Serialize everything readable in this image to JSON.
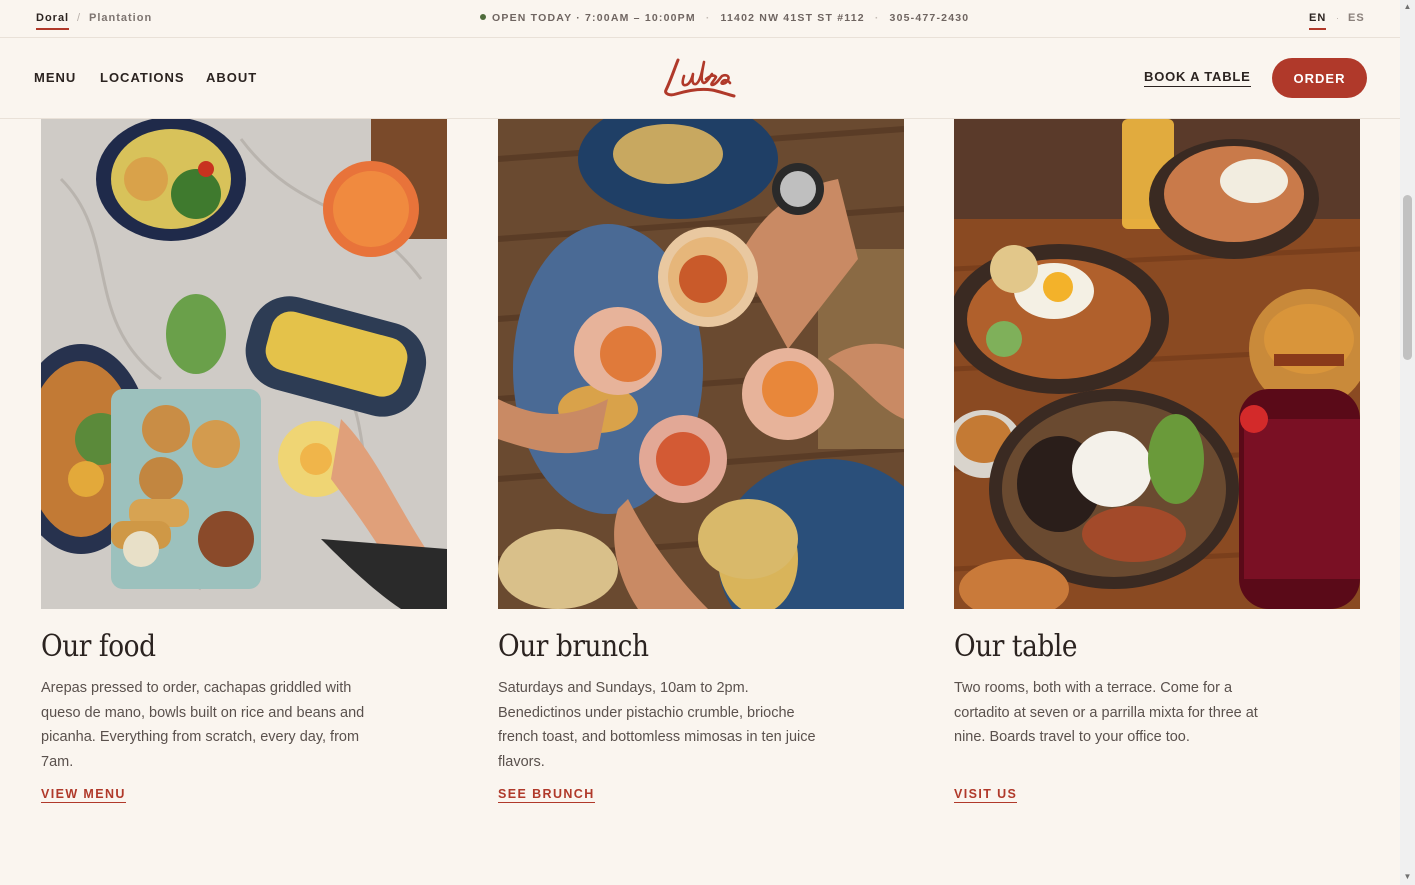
{
  "topbar": {
    "locations": [
      "Doral",
      "Plantation"
    ],
    "status": "OPEN TODAY · 7:00AM – 10:00PM",
    "address": "11402 NW 41ST ST #112",
    "phone": "305-477-2430",
    "languages": [
      "EN",
      "ES"
    ]
  },
  "nav": {
    "links": [
      "MENU",
      "LOCATIONS",
      "ABOUT"
    ],
    "logo": "Luka",
    "book_label": "BOOK A TABLE",
    "order_label": "ORDER"
  },
  "cards": [
    {
      "title": "Our food",
      "description": "Arepas pressed to order, cachapas griddled with queso de mano, bowls built on rice and beans and picanha. Everything from scratch, every day, from 7am.",
      "link": "VIEW MENU"
    },
    {
      "title": "Our brunch",
      "description": "Saturdays and Sundays, 10am to 2pm. Benedictinos under pistachio crumble, brioche french toast, and bottomless mimosas in ten juice flavors.",
      "link": "SEE BRUNCH"
    },
    {
      "title": "Our table",
      "description": "Two rooms, both with a terrace. Come for a cortadito at seven or a parrilla mixta for three at nine. Boards travel to your office too.",
      "link": "VISIT US"
    }
  ],
  "colors": {
    "accent": "#b0392a",
    "background": "#faf5ef",
    "status_dot": "#4e6b3b"
  }
}
